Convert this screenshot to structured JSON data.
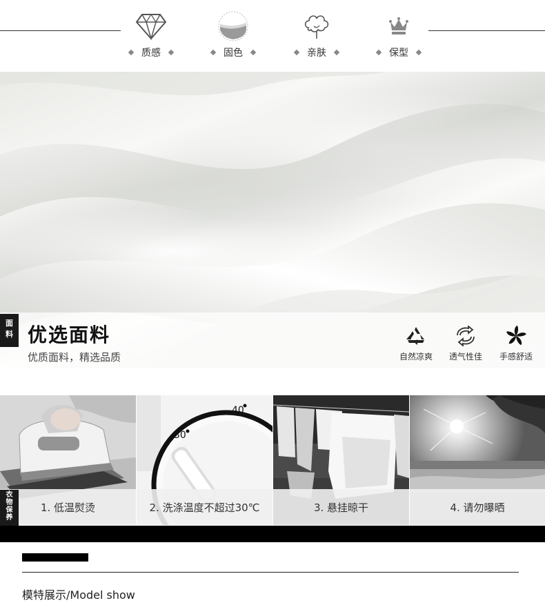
{
  "features": [
    {
      "icon": "diamond-icon",
      "label": "质感"
    },
    {
      "icon": "swatch-icon",
      "label": "固色"
    },
    {
      "icon": "cotton-icon",
      "label": "亲肤"
    },
    {
      "icon": "crown-icon",
      "label": "保型"
    }
  ],
  "fabric": {
    "tag": "面料",
    "title": "优选面料",
    "subtitle": "优质面料，精选品质",
    "features": [
      {
        "icon": "recycle-icon",
        "label": "自然凉爽"
      },
      {
        "icon": "airflow-icon",
        "label": "透气性佳"
      },
      {
        "icon": "flower-icon",
        "label": "手感舒适"
      }
    ]
  },
  "care": {
    "tag": "衣物保养",
    "items": [
      {
        "label": "1. 低温熨烫"
      },
      {
        "label": "2. 洗涤温度不超过30℃"
      },
      {
        "label": "3. 悬挂晾干"
      },
      {
        "label": "4. 请勿曝晒"
      }
    ],
    "dial": {
      "t30": "30",
      "t40": "40"
    }
  },
  "model": {
    "title": "模特展示/Model show"
  }
}
